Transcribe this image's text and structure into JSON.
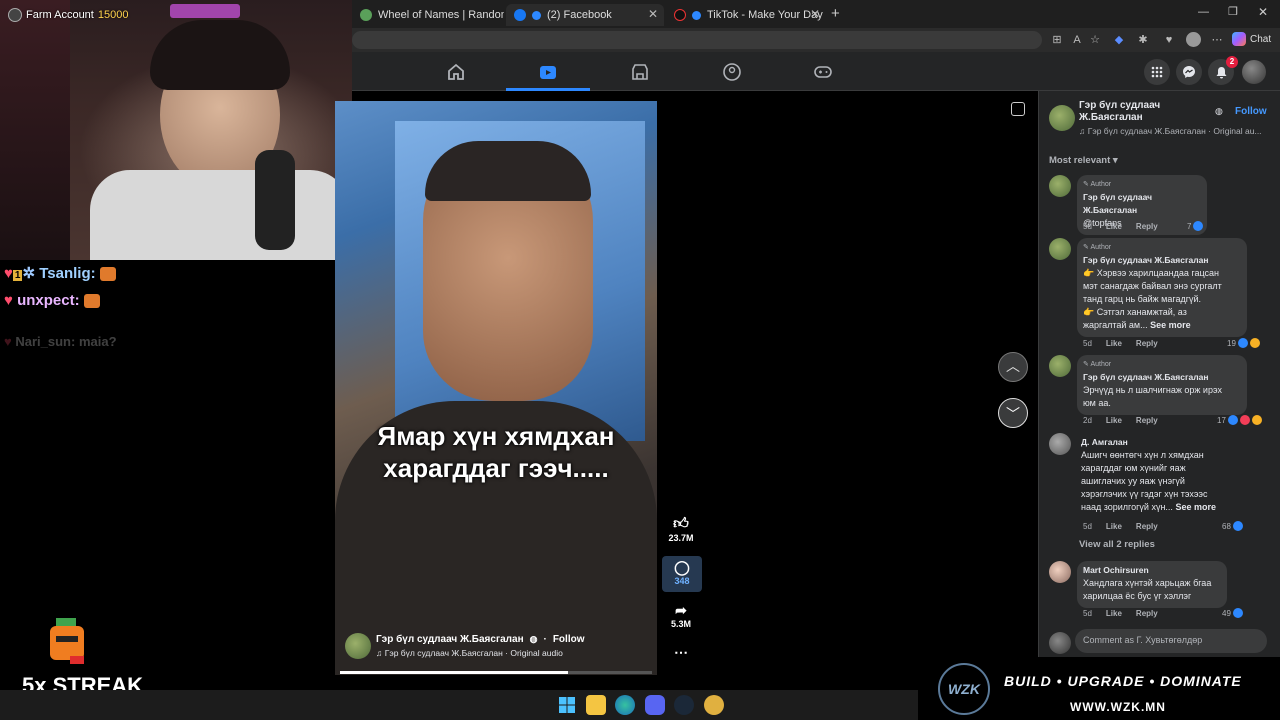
{
  "browser": {
    "tabs": [
      {
        "title": "Wheel of Names | Random name pi",
        "active": false
      },
      {
        "title": "(2) Facebook",
        "active": true
      },
      {
        "title": "TikTok - Make Your Day",
        "active": false
      }
    ],
    "copilot_label": "Chat"
  },
  "overlay": {
    "account_label": "Farm Account",
    "account_points": "15000",
    "chat": [
      {
        "user": "Tsanlig:"
      },
      {
        "user": "unxpect:"
      },
      {
        "user": "Nari_sun:",
        "text": "maia?"
      }
    ],
    "streak": "5x STREAK",
    "sponsor_tagline": "BUILD • UPGRADE • DOMINATE",
    "sponsor_url": "WWW.WZK.MN",
    "sponsor_logo": "WZK"
  },
  "facebook": {
    "notification_count": "2",
    "video": {
      "caption_line1": "Ямар хүн хямдхан",
      "caption_line2": "харагддаг гээч.....",
      "likes": "23.7M",
      "comments": "348",
      "shares": "5.3M",
      "author": "Гэр бүл судлаач Ж.Баясгалан",
      "follow": "Follow",
      "audio": "Гэр бүл судлаач Ж.Баясгалан · Original audio"
    },
    "panel": {
      "author_line1": "Гэр бүл судлаач",
      "author_line2": "Ж.Баясгалан",
      "follow": "Follow",
      "audio": "Гэр бүл судлаач Ж.Баясгалан · Original au...",
      "sort": "Most relevant",
      "comments": [
        {
          "badge": "Author",
          "name": "Гэр бүл судлаач Ж.Баясгалан",
          "text": "@topfans",
          "time": "5d",
          "like": "Like",
          "reply": "Reply",
          "count": "7"
        },
        {
          "badge": "Author",
          "name": "Гэр бүл судлаач Ж.Баясгалан",
          "text1": "👉 Хэрвээ харилцаандаа гацсан",
          "text2": "мэт санагдаж байвал энэ сургалт",
          "text3": "танд гарц нь байж магадгүй.",
          "text4": "👉 Сэтгэл ханамжтай, аз",
          "text5": "жаргалтай ам...",
          "see_more": "See more",
          "time": "5d",
          "like": "Like",
          "reply": "Reply",
          "count": "19"
        },
        {
          "badge": "Author",
          "name": "Гэр бүл судлаач Ж.Баясгалан",
          "text1": "Эрчүүд нь л шалчигнаж орж ирэх",
          "text2": "юм аа.",
          "time": "2d",
          "like": "Like",
          "reply": "Reply",
          "count": "17"
        },
        {
          "name": "Д. Амгалан",
          "text1": "Ашигч өөнтөгч хүн л хямдхан",
          "text2": "харагддаг юм хүнийг яаж",
          "text3": "ашиглачих уу яаж үнэгүй",
          "text4": "хэрэглэчих үү гэдэг хүн тэхээс",
          "text5": "наад зорилгогүй хүн...",
          "see_more": "See more",
          "time": "5d",
          "like": "Like",
          "reply": "Reply",
          "count": "68",
          "view_replies": "View all 2 replies"
        },
        {
          "name": "Mart Ochirsuren",
          "text1": "Хандлага хүнтэй харьцаж бгаа",
          "text2": "харилцаа ёс бус үг хэллэг",
          "time": "5d",
          "like": "Like",
          "reply": "Reply",
          "count": "49"
        }
      ],
      "comment_placeholder": "Comment as Г. Хувьтөгөлдөр"
    }
  },
  "colors": {
    "fb_blue": "#2d88ff",
    "panel_bg": "#242526",
    "bubble": "#3a3b3c",
    "accent_follow": "#4599ff"
  }
}
